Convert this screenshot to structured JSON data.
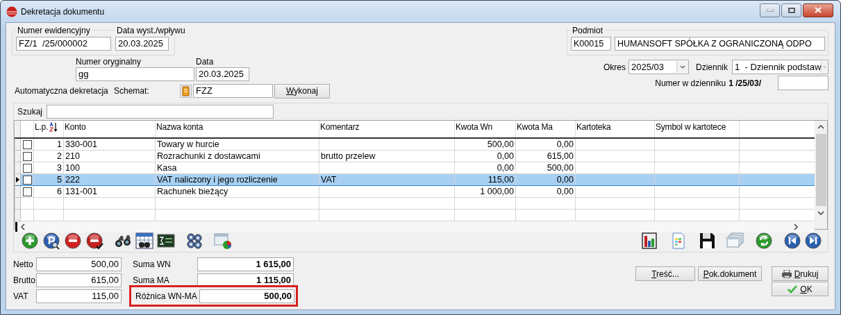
{
  "window": {
    "title": "Dekretacja dokumentu"
  },
  "numer_ewidencyjny": {
    "label": "Numer ewidencyjny",
    "value": "FZ/1  /25/000002"
  },
  "data_wystawienia": {
    "label": "Data wyst./wpływu",
    "value": "20.03.2025"
  },
  "numer_oryginalny": {
    "label": "Numer oryginalny",
    "value": "gg"
  },
  "data": {
    "label": "Data",
    "value": "20.03.2025"
  },
  "automatyczna_dekretacja": {
    "label": "Automatyczna dekretacja",
    "schemat_label": "Schemat:",
    "schemat": "FZZ",
    "button": "Wykonaj"
  },
  "podmiot": {
    "label": "Podmiot",
    "code": "K00015",
    "name": "HUMANSOFT SPÓŁKA Z OGRANICZONĄ ODPO"
  },
  "okres": {
    "label": "Okres",
    "value": "2025/03"
  },
  "dziennik": {
    "label": "Dziennik",
    "value": "1  - Dziennik podstaw"
  },
  "numer_w_dzienniku": {
    "label": "Numer w dzienniku",
    "value": "1 /25/03/"
  },
  "search": {
    "label": "Szukaj"
  },
  "table": {
    "columns": [
      {
        "label": "L.p.",
        "kind": "number"
      },
      {
        "label": "Konto",
        "kind": "text"
      },
      {
        "label": "Nazwa konta",
        "kind": "text"
      },
      {
        "label": "Komentarz",
        "kind": "text"
      },
      {
        "label": "Kwota Wn",
        "kind": "number"
      },
      {
        "label": "Kwota Ma",
        "kind": "number"
      },
      {
        "label": "Kartoteka",
        "kind": "text"
      },
      {
        "label": "Symbol w kartotece",
        "kind": "text"
      }
    ],
    "rows": [
      {
        "lp": "1",
        "konto": "330-001",
        "nazwa_konta": "Towary w hurcie",
        "kwota_wn": "500,00",
        "kwota_ma": "0,00",
        "checked": false,
        "selected": false
      },
      {
        "lp": "2",
        "konto": "210",
        "nazwa_konta": "Rozrachunki z dostawcami",
        "komentarz": "brutto przelew",
        "kwota_wn": "0,00",
        "kwota_ma": "615,00",
        "checked": false,
        "selected": false
      },
      {
        "lp": "3",
        "konto": "100",
        "nazwa_konta": "Kasa",
        "kwota_wn": "0,00",
        "kwota_ma": "500,00",
        "checked": false,
        "selected": false
      },
      {
        "lp": "5",
        "konto": "222",
        "nazwa_konta": "VAT naliczony i jego rozliczenie",
        "komentarz": "VAT",
        "kwota_wn": "115,00",
        "kwota_ma": "0,00",
        "checked": false,
        "selected": true
      },
      {
        "lp": "6",
        "konto": "131-001",
        "nazwa_konta": "Rachunek bieżący",
        "kwota_wn": "1 000,00",
        "kwota_ma": "0,00",
        "checked": false,
        "selected": false
      }
    ]
  },
  "totals_left": [
    {
      "label": "Netto",
      "value": "500,00"
    },
    {
      "label": "Brutto",
      "value": "615,00"
    },
    {
      "label": "VAT",
      "value": "115,00"
    }
  ],
  "totals_right": [
    {
      "label": "Suma WN",
      "value": "1 615,00",
      "highlighted": false
    },
    {
      "label": "Suma MA",
      "value": "1 115,00",
      "highlighted": false
    },
    {
      "label": "Różnica WN-MA",
      "value": "500,00",
      "highlighted": true
    }
  ],
  "buttons": [
    {
      "label": "Treść...",
      "kind": "plain"
    },
    {
      "label": "Pok.dokument",
      "kind": "plain"
    },
    {
      "label": "Drukuj",
      "kind": "print"
    },
    {
      "label": "OK",
      "kind": "ok"
    }
  ]
}
